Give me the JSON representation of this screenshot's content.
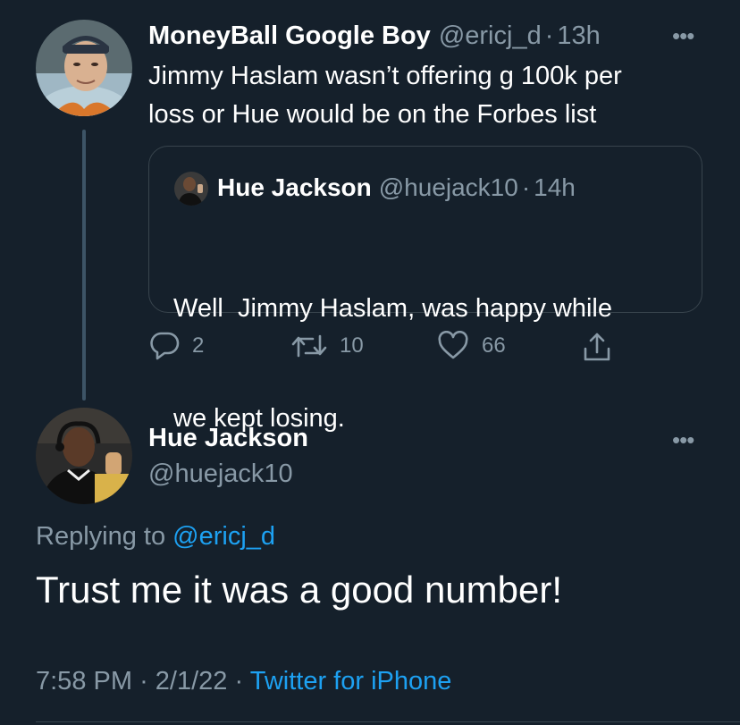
{
  "tweet1": {
    "display_name": "MoneyBall Google Boy",
    "handle": "@ericj_d",
    "separator": "·",
    "time": "13h",
    "text_line1": "Jimmy Haslam wasn’t offering g 100k per",
    "text_line2": "loss or Hue would be on the Forbes list",
    "more_label": "•••"
  },
  "quoted": {
    "display_name": "Hue Jackson",
    "handle": "@huejack10",
    "separator": "·",
    "time": "14h",
    "text_line1": "Well  Jimmy Haslam, was happy while",
    "text_line2": "we kept losing."
  },
  "actions": {
    "reply_count": "2",
    "retweet_count": "10",
    "like_count": "66"
  },
  "tweet2": {
    "display_name": "Hue Jackson",
    "handle": "@huejack10",
    "more_label": "•••",
    "replying_prefix": "Replying to",
    "replying_handle": "@ericj_d",
    "text": "Trust me it was a good number!",
    "time": "7:58 PM",
    "separator1": "·",
    "date": "2/1/22",
    "separator2": "·",
    "source": "Twitter for iPhone"
  },
  "icons": {
    "reply": "reply-icon",
    "retweet": "retweet-icon",
    "like": "heart-icon",
    "share": "share-icon"
  },
  "colors": {
    "background": "#15202b",
    "text": "#ffffff",
    "muted": "#8899a6",
    "accent": "#1da1f2",
    "border": "#38444d"
  }
}
